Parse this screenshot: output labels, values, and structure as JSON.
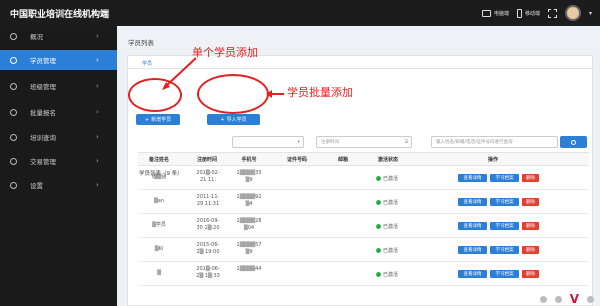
{
  "header": {
    "title": "中国职业培训在线机构端",
    "pc_label": "电脑端",
    "mobile_label": "移动端"
  },
  "sidebar": {
    "items": [
      {
        "label": "概况",
        "icon": "dashboard-icon",
        "active": false
      },
      {
        "label": "学员管理",
        "icon": "users-icon",
        "active": true
      },
      {
        "label": "班级管理",
        "icon": "class-icon",
        "active": false
      },
      {
        "label": "批量报名",
        "icon": "enroll-icon",
        "active": false
      },
      {
        "label": "培训查询",
        "icon": "search-icon",
        "active": false
      },
      {
        "label": "交易管理",
        "icon": "trade-icon",
        "active": false
      },
      {
        "label": "设置",
        "icon": "settings-icon",
        "active": false
      }
    ]
  },
  "main": {
    "page_title": "学员列表",
    "tab": "学员",
    "add_button": "新增学员",
    "import_button": "导入学员",
    "filter_placeholder_1": "",
    "filter_placeholder_2": "注册时间",
    "search_placeholder": "输入姓名/邮箱/电话/证件号码进行查询",
    "count_label": "学员列表（9 条）"
  },
  "table": {
    "columns": [
      "备注姓名",
      "注册时间",
      "手机号",
      "证件号码",
      "邮箱",
      "激活状态",
      "操作"
    ],
    "rows": [
      {
        "name": "f▒▒涵",
        "date1": "201▒-02-",
        "date2": "21 11:",
        "phone1": "1▒▒▒▒33",
        "phone2": "▒9",
        "status": "已激活"
      },
      {
        "name": "▒an",
        "date1": "2011-11-",
        "date2": "29 11:31",
        "phone1": "1▒▒▒▒92",
        "phone2": "▒4",
        "status": "已激活"
      },
      {
        "name": "▒学员",
        "date1": "2016-09-",
        "date2": "30 1▒:20",
        "phone1": "1▒▒▒▒28",
        "phone2": "▒04",
        "status": "已激活"
      },
      {
        "name": "▒Ki",
        "date1": "2015-06-",
        "date2": "2▒ 19:00",
        "phone1": "1▒▒▒▒57",
        "phone2": "▒9",
        "status": "已激活"
      },
      {
        "name": "▒",
        "date1": "201▒-06-",
        "date2": "2▒ 1▒:33",
        "phone1": "1▒▒▒▒44",
        "phone2": "",
        "status": "已激活"
      }
    ],
    "actions": {
      "view": "查看详情",
      "study": "学习档案",
      "delete": "删除"
    }
  },
  "annotations": {
    "single_add": "单个学员添加",
    "batch_add": "学员批量添加"
  },
  "colors": {
    "topbar": "#1c1c1c",
    "sidebar": "#1a1a1a",
    "accent": "#2b7fd6",
    "danger": "#e04133",
    "annotation": "#e4201f",
    "active_status": "#2fae4f"
  }
}
